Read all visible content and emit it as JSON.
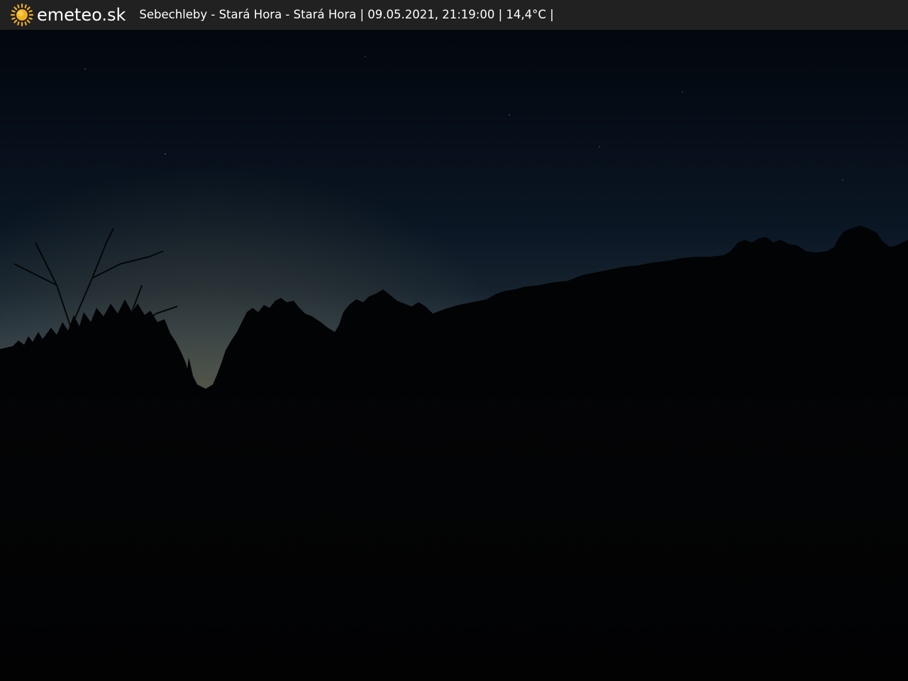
{
  "header": {
    "brand": "emeteo.sk",
    "logo_icon": "sun-icon",
    "caption": "Sebechleby - Stará Hora - Stará Hora | 09.05.2021, 21:19:00 | 14,4°C |"
  },
  "colors": {
    "bar_background": "#212121",
    "sun": "#f2b01e",
    "sky_top": "#03080f",
    "sky_horizon": "#34424c",
    "ground": "#020304"
  }
}
